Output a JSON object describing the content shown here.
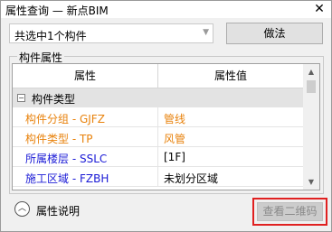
{
  "window": {
    "title": "属性查询 — 新点BIM",
    "close_glyph": "✕"
  },
  "selection": {
    "value": "共选中1个构件"
  },
  "action_button": {
    "label": "做法"
  },
  "section": {
    "label": "构件属性"
  },
  "grid": {
    "columns": [
      "属性",
      "属性值"
    ],
    "category": {
      "toggle": "⊟",
      "label": "构件类型"
    },
    "rows": [
      {
        "name": "构件分组 - GJFZ",
        "value": "管线",
        "name_color": "#e8820c",
        "value_color": "#e8820c"
      },
      {
        "name": "构件类型 - TP",
        "value": "风管",
        "name_color": "#e8820c",
        "value_color": "#e8820c"
      },
      {
        "name": "所属楼层 - SSLC",
        "value": "[1F]",
        "name_color": "#1a1ad6",
        "value_color": "#000000"
      },
      {
        "name": "施工区域 - FZBH",
        "value": "未划分区域",
        "name_color": "#1a1ad6",
        "value_color": "#000000"
      }
    ]
  },
  "footer": {
    "toggle_glyph": "⌃",
    "description_label": "属性说明",
    "qr_button_label": "查看二维码"
  },
  "colors": {
    "highlight": "#e02020",
    "orange_text": "#e8820c",
    "blue_text": "#1a1ad6"
  }
}
